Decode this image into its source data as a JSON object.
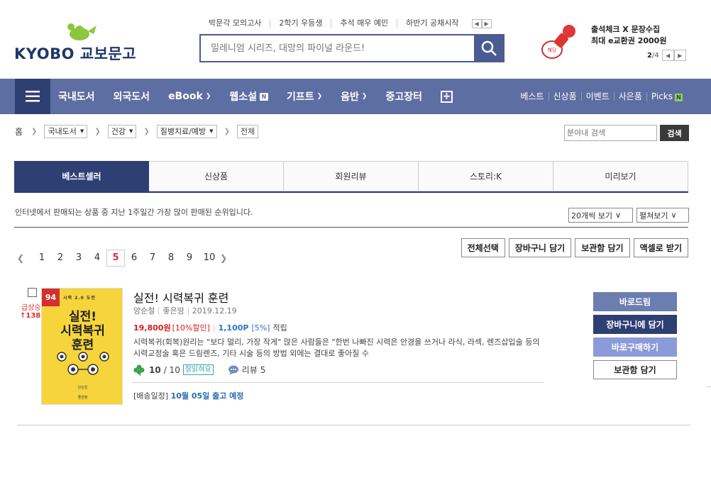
{
  "header": {
    "logo_text": "KYOBO 교보문고",
    "hot_links": [
      "박문각 모의고사",
      "2학기 우등생",
      "추석 매우 예민",
      "하반기 공채시작"
    ],
    "search_placeholder": "밀레니엄 시리즈, 대망의 파이널 라운드!",
    "promo_line1": "출석체크 X 문장수집",
    "promo_line2": "최대 e교환권 2000원",
    "promo_page_current": "2",
    "promo_page_total": "/4",
    "promo_stamp_label": "해당"
  },
  "nav": {
    "items": [
      {
        "label": "국내도서"
      },
      {
        "label": "외국도서"
      },
      {
        "label": "eBook"
      },
      {
        "label": "웹소설",
        "badge": "N"
      },
      {
        "label": "기프트"
      },
      {
        "label": "음반"
      },
      {
        "label": "중고장터"
      }
    ],
    "right_links": [
      "베스트",
      "신상품",
      "이벤트",
      "사은품",
      "Picks"
    ],
    "picks_badge": "N"
  },
  "breadcrumb": {
    "home": "홈",
    "levels": [
      "국내도서",
      "건강",
      "질병치료/예방"
    ],
    "last": "전체",
    "inner_search_placeholder": "분야내 검색",
    "inner_search_button": "검색"
  },
  "tabs": [
    "베스트셀러",
    "신상품",
    "회원리뷰",
    "스토리:K",
    "미리보기"
  ],
  "list_info": {
    "description": "인터넷에서 판매되는 상품 중 지난 1주일간 가장 많이 판매된 순위입니다.",
    "per_page": "20개씩 보기",
    "view_mode": "펼쳐보기"
  },
  "pagination": {
    "pages": [
      "1",
      "2",
      "3",
      "4",
      "5",
      "6",
      "7",
      "8",
      "9",
      "10"
    ],
    "current": "5"
  },
  "bulk_actions": [
    "전체선택",
    "장바구니 담기",
    "보관함 담기",
    "액셀로 받기"
  ],
  "item": {
    "rank": "94",
    "rank_status": "급상승",
    "rank_delta": "↑138",
    "cover_sub": "시력 2.0 도전",
    "cover_title_1": "실전!",
    "cover_title_2": "시력복귀",
    "cover_title_3": "훈련",
    "title": "실전! 시력복귀 훈련",
    "author": "양순철",
    "publisher": "좋은땅",
    "date": "2019.12.19",
    "price": "19,800원",
    "discount": "[10%할인]",
    "points": "1,100P",
    "points_pct": "[5%]",
    "points_label": "적립",
    "summary": "시력복귀(회복)원리는 \"보다 멀리, 가장 작게\" 많은 사람들은 \"한번 나빠진 시력은 안경을 쓰거나 라식, 라섹, 렌즈삽입술 등의 시력교정술 혹은 드림렌즈, 기타 시술 등의 방법 외에는 결대로 좋아질 수",
    "score": "10",
    "score_max": "/ 10",
    "score_badge": "잘읽혀요",
    "review_label": "리뷰",
    "review_count": "5",
    "ship_label": "[배송일정]",
    "ship_date": "10월 05일 출고 예정",
    "buttons": [
      "바로드림",
      "장바구니에 담기",
      "바로구매하기",
      "보관함 담기"
    ]
  },
  "colors": {
    "nav_bg": "#5d6ea2",
    "nav_dark": "#2e3f74",
    "accent_red": "#d31f1f",
    "cover_yellow": "#f6d43b"
  }
}
